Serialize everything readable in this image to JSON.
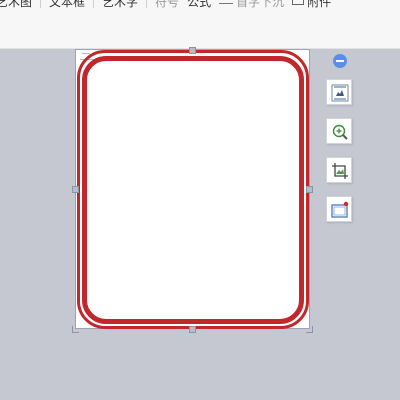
{
  "ribbon": {
    "items": [
      {
        "label": "艺术图",
        "dim": false
      },
      {
        "label": "文本框",
        "dim": false
      },
      {
        "label": "艺术字",
        "dim": false
      },
      {
        "label": "符号",
        "dim": true
      },
      {
        "label": "公式",
        "dim": false
      },
      {
        "label": "首字下沉",
        "dim": true,
        "icon": "text-lines-icon"
      },
      {
        "label": "附件",
        "dim": false,
        "icon": "attachment-icon"
      }
    ]
  },
  "colors": {
    "frame_red": "#c0282d",
    "canvas_bg": "#c5c8d0",
    "accent_blue": "#5b8ee8"
  },
  "tools": [
    {
      "name": "layout-options-icon"
    },
    {
      "name": "zoom-in-icon"
    },
    {
      "name": "crop-icon"
    },
    {
      "name": "border-icon"
    }
  ]
}
